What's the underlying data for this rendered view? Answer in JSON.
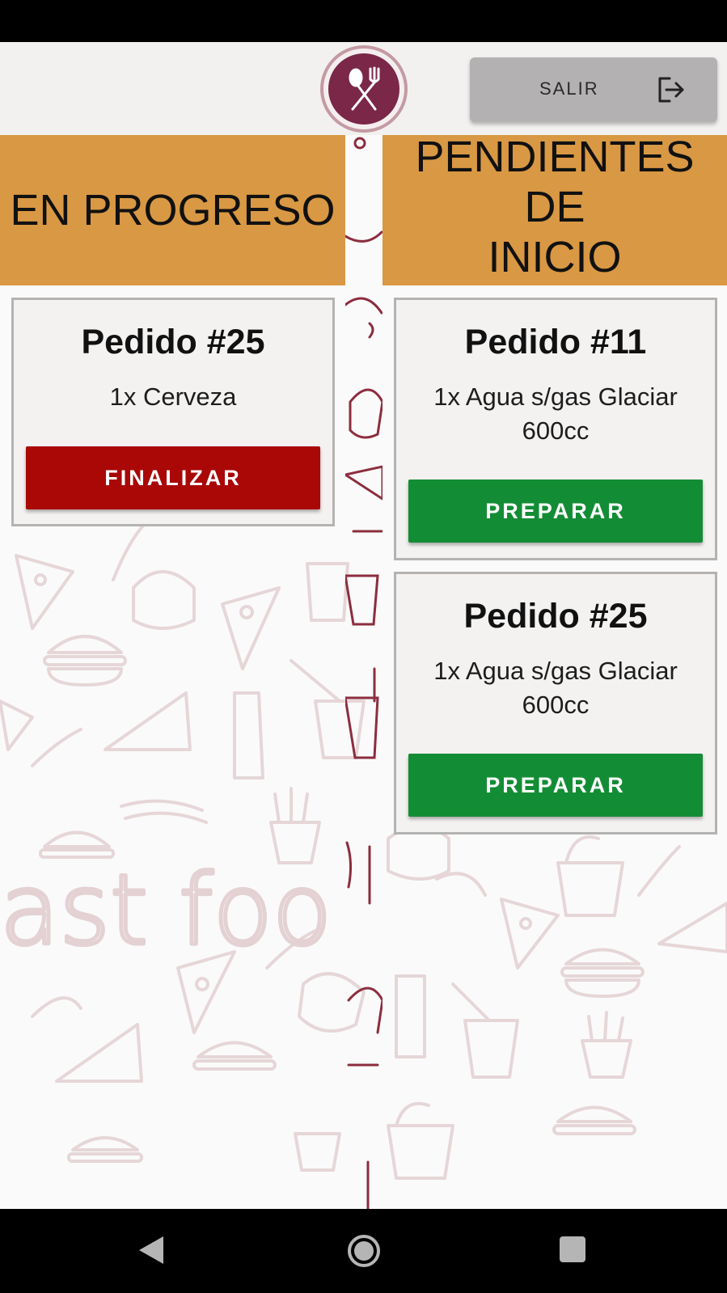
{
  "header": {
    "logout_label": "SALIR",
    "logo_icon": "spoon-fork-icon",
    "logout_icon": "logout-icon"
  },
  "columns": {
    "in_progress": {
      "title": "EN PROGRESO"
    },
    "pending": {
      "title_line1": "PENDIENTES DE",
      "title_line2": "INICIO"
    }
  },
  "in_progress_orders": [
    {
      "title": "Pedido #25",
      "items": "1x Cerveza",
      "action": "FINALIZAR"
    }
  ],
  "pending_orders": [
    {
      "title": "Pedido #11",
      "items_line1": "1x Agua s/gas Glaciar",
      "items_line2": "600cc",
      "action": "PREPARAR"
    },
    {
      "title": "Pedido #25",
      "items_line1": "1x Agua s/gas Glaciar",
      "items_line2": "600cc",
      "action": "PREPARAR"
    }
  ],
  "nav": {
    "back_icon": "back-triangle-icon",
    "home_icon": "home-circle-icon",
    "recents_icon": "recents-square-icon"
  },
  "colors": {
    "header_orange": "#d99843",
    "finalize_red": "#aa0707",
    "prepare_green": "#138d35",
    "logo_maroon": "#7a2748"
  }
}
